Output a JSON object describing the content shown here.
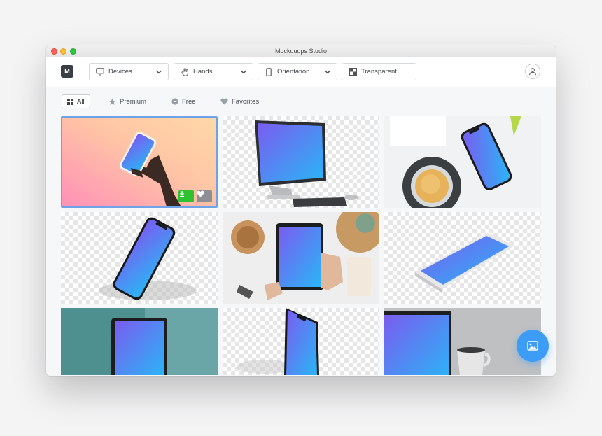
{
  "window": {
    "title": "Mockuuups Studio"
  },
  "toolbar": {
    "logo": "M",
    "devices": {
      "label": "Devices",
      "icon": "monitor-icon"
    },
    "hands": {
      "label": "Hands",
      "icon": "hand-icon"
    },
    "orientation": {
      "label": "Orientation",
      "icon": "phone-portrait-icon"
    },
    "transparent": {
      "label": "Transparent",
      "icon": "transparency-icon"
    },
    "account_icon": "user-icon"
  },
  "filters": {
    "all": "All",
    "premium": "Premium",
    "free": "Free",
    "favorites": "Favorites"
  },
  "tile_actions": {
    "download_icon": "download-icon",
    "favorite_icon": "heart-icon"
  },
  "colors": {
    "accent_blue": "#3d9cf5",
    "download_green": "#2ec232",
    "selected_border": "#6ea3ea"
  }
}
